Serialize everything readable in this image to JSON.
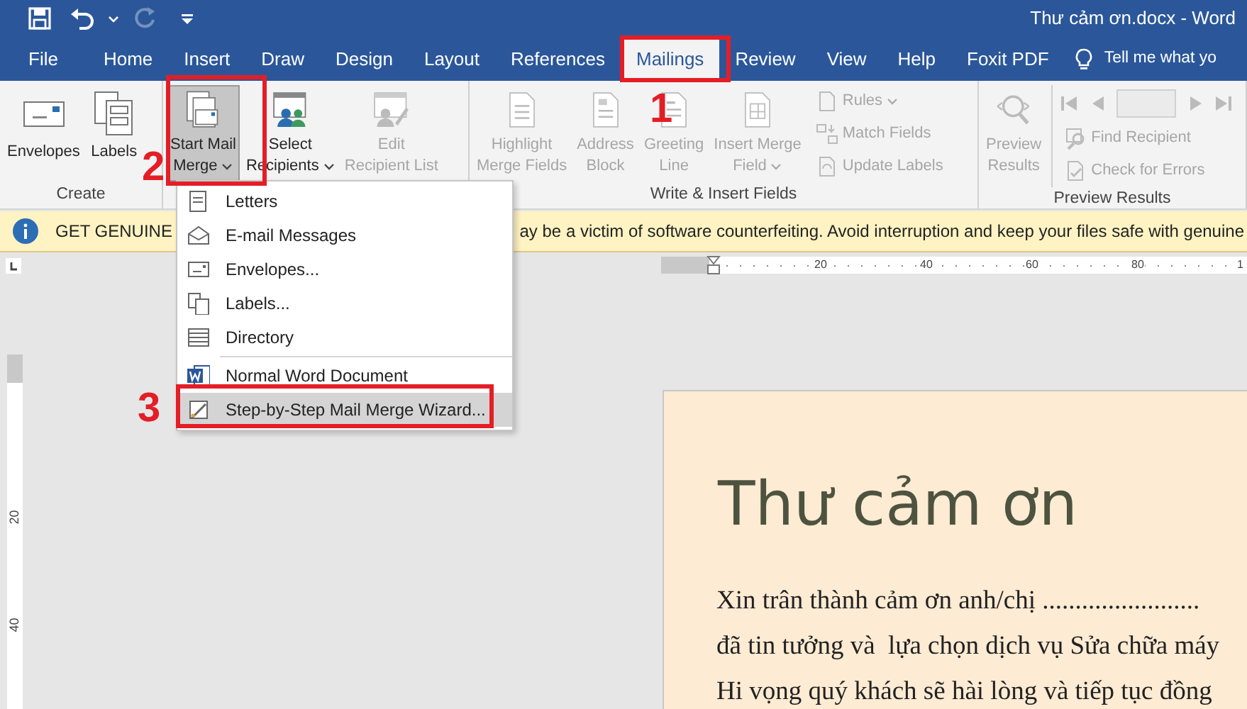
{
  "title_bar": {
    "title": "Thư cảm ơn.docx - Word",
    "quick_access": [
      {
        "kind": "save",
        "disabled": false
      },
      {
        "kind": "undo",
        "disabled": false
      },
      {
        "kind": "redo",
        "disabled": true
      },
      {
        "kind": "customize",
        "disabled": false
      }
    ]
  },
  "tabs": [
    {
      "label": "File",
      "selected": false
    },
    {
      "label": "Home",
      "selected": false
    },
    {
      "label": "Insert",
      "selected": false
    },
    {
      "label": "Draw",
      "selected": false
    },
    {
      "label": "Design",
      "selected": false
    },
    {
      "label": "Layout",
      "selected": false
    },
    {
      "label": "References",
      "selected": false
    },
    {
      "label": "Mailings",
      "selected": true
    },
    {
      "label": "Review",
      "selected": false
    },
    {
      "label": "View",
      "selected": false
    },
    {
      "label": "Help",
      "selected": false
    },
    {
      "label": "Foxit PDF",
      "selected": false
    }
  ],
  "tell_me": "Tell me what yo",
  "ribbon": {
    "groups": [
      {
        "label": "Create",
        "items": [
          {
            "kind": "large",
            "lines": [
              "Envelopes"
            ],
            "disabled": false,
            "pressed": false,
            "dropdown": false
          },
          {
            "kind": "large",
            "lines": [
              "Labels"
            ],
            "disabled": false,
            "pressed": false,
            "dropdown": false
          }
        ]
      },
      {
        "items": [
          {
            "kind": "large",
            "lines": [
              "Start Mail",
              "Merge"
            ],
            "disabled": false,
            "pressed": true,
            "dropdown": true
          },
          {
            "kind": "large",
            "lines": [
              "Select",
              "Recipients"
            ],
            "disabled": false,
            "pressed": false,
            "dropdown": true
          },
          {
            "kind": "large",
            "lines": [
              "Edit",
              "Recipient List"
            ],
            "disabled": true,
            "pressed": false,
            "dropdown": false
          }
        ]
      },
      {
        "label": "Write & Insert Fields",
        "items": [
          {
            "kind": "large",
            "lines": [
              "Highlight",
              "Merge Fields"
            ],
            "disabled": true,
            "pressed": false,
            "dropdown": false
          },
          {
            "kind": "large",
            "lines": [
              "Address",
              "Block"
            ],
            "disabled": true,
            "pressed": false,
            "dropdown": false
          },
          {
            "kind": "large",
            "lines": [
              "Greeting",
              "Line"
            ],
            "disabled": true,
            "pressed": false,
            "dropdown": false
          },
          {
            "kind": "large",
            "lines": [
              "Insert Merge",
              "Field"
            ],
            "disabled": true,
            "pressed": false,
            "dropdown": true
          },
          {
            "kind": "small",
            "lines": [
              "Rules"
            ],
            "disabled": true,
            "pressed": false,
            "dropdown": true
          },
          {
            "kind": "small",
            "lines": [
              "Match Fields"
            ],
            "disabled": true,
            "pressed": false,
            "dropdown": false
          },
          {
            "kind": "small",
            "lines": [
              "Update Labels"
            ],
            "disabled": true,
            "pressed": false,
            "dropdown": false
          }
        ]
      },
      {
        "label": "Preview Results",
        "items": [
          {
            "kind": "large",
            "lines": [
              "Preview",
              "Results"
            ],
            "disabled": true,
            "pressed": false,
            "dropdown": false
          },
          {
            "kind": "nav",
            "disabled": true
          },
          {
            "kind": "small",
            "lines": [
              "Find Recipient"
            ],
            "disabled": true,
            "pressed": false,
            "dropdown": false
          },
          {
            "kind": "small",
            "lines": [
              "Check for Errors"
            ],
            "disabled": true,
            "pressed": false,
            "dropdown": false
          }
        ]
      }
    ]
  },
  "notice": {
    "text_left": "GET GENUINE",
    "text_right": "ay be a victim of software counterfeiting. Avoid interruption and keep your files safe with genuine"
  },
  "ruler": {
    "labels": [
      "20",
      "40",
      "60",
      "80",
      "1"
    ],
    "vertical_labels": [
      "20",
      "40"
    ]
  },
  "document": {
    "title": "Thư cảm ơn",
    "lines": [
      "Xin trân thành cảm ơn anh/chị ........................",
      "đã tin tưởng và  lựa chọn dịch vụ Sửa chữa máy",
      "Hi vọng quý khách sẽ hài lòng và tiếp tục đồng"
    ]
  },
  "menu": {
    "items": [
      {
        "kind": "item",
        "label": "Letters",
        "selected": false
      },
      {
        "kind": "item",
        "label": "E-mail Messages",
        "selected": false
      },
      {
        "kind": "item",
        "label": "Envelopes...",
        "selected": false
      },
      {
        "kind": "item",
        "label": "Labels...",
        "selected": false
      },
      {
        "kind": "item",
        "label": "Directory",
        "selected": false
      },
      {
        "kind": "separator"
      },
      {
        "kind": "item",
        "label": "Normal Word Document",
        "selected": false
      },
      {
        "kind": "item",
        "label": "Step-by-Step Mail Merge Wizard...",
        "selected": true
      }
    ]
  },
  "annotations": [
    {
      "number": "1"
    },
    {
      "number": "2"
    },
    {
      "number": "3"
    }
  ]
}
